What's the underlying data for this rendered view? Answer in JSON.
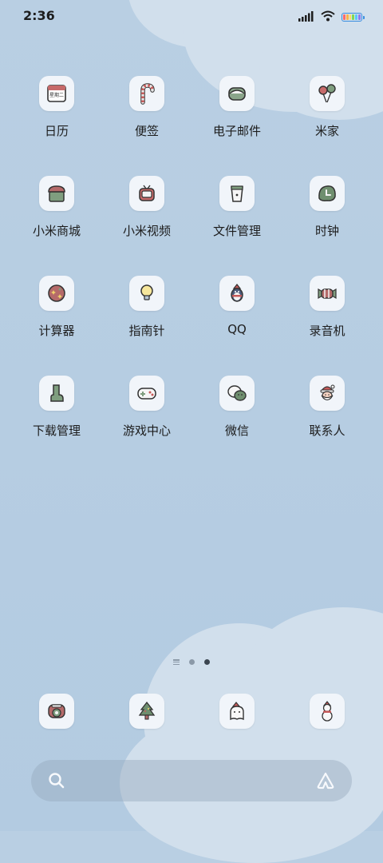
{
  "status_bar": {
    "time": "2:36",
    "signal_icon": "signal-icon",
    "wifi_icon": "wifi-icon",
    "battery_icon": "battery-icon",
    "battery_colors": [
      "#ff6b6b",
      "#ffb347",
      "#ffe066",
      "#7ed957",
      "#5ac8fa",
      "#8e7cf0"
    ]
  },
  "apps": [
    {
      "label": "日历",
      "icon": "calendar-icon",
      "icon_text": "星期二"
    },
    {
      "label": "便签",
      "icon": "candy-cane-icon"
    },
    {
      "label": "电子邮件",
      "icon": "email-icon"
    },
    {
      "label": "米家",
      "icon": "balloons-icon"
    },
    {
      "label": "小米商城",
      "icon": "cake-shop-icon"
    },
    {
      "label": "小米视频",
      "icon": "tv-icon"
    },
    {
      "label": "文件管理",
      "icon": "cup-icon"
    },
    {
      "label": "时钟",
      "icon": "clock-icon"
    },
    {
      "label": "计算器",
      "icon": "ornament-icon"
    },
    {
      "label": "指南针",
      "icon": "lightbulb-icon"
    },
    {
      "label": "QQ",
      "icon": "penguin-icon"
    },
    {
      "label": "录音机",
      "icon": "candy-icon"
    },
    {
      "label": "下载管理",
      "icon": "mitten-icon"
    },
    {
      "label": "游戏中心",
      "icon": "gamepad-icon"
    },
    {
      "label": "微信",
      "icon": "chat-bubbles-icon"
    },
    {
      "label": "联系人",
      "icon": "santa-icon"
    }
  ],
  "dock": [
    {
      "icon": "phone-icon"
    },
    {
      "icon": "christmas-tree-icon"
    },
    {
      "icon": "ghost-icon"
    },
    {
      "icon": "snowman-icon"
    }
  ],
  "search": {
    "search_icon": "search-icon",
    "assistant_icon": "assistant-icon"
  }
}
